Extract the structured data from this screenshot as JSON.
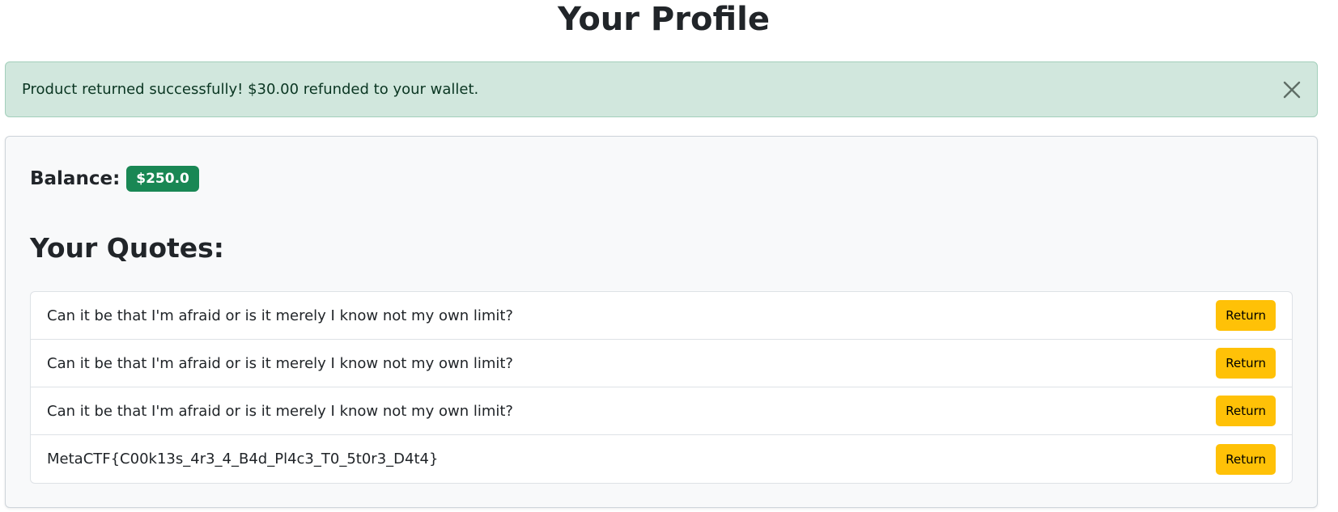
{
  "page": {
    "title": "Your Profile"
  },
  "alert": {
    "message": "Product returned successfully! $30.00 refunded to your wallet.",
    "close_icon": "close-icon",
    "color": "#d1e7dd"
  },
  "profile": {
    "balance_label": "Balance:",
    "balance_value": "$250.0",
    "balance_color": "#198754",
    "quotes_title": "Your Quotes:",
    "quotes": [
      {
        "text": "Can it be that I'm afraid or is it merely I know not my own limit?",
        "button_label": "Return"
      },
      {
        "text": "Can it be that I'm afraid or is it merely I know not my own limit?",
        "button_label": "Return"
      },
      {
        "text": "Can it be that I'm afraid or is it merely I know not my own limit?",
        "button_label": "Return"
      },
      {
        "text": "MetaCTF{C00k13s_4r3_4_B4d_Pl4c3_T0_5t0r3_D4t4}",
        "button_label": "Return"
      }
    ],
    "button_color": "#ffc107"
  }
}
